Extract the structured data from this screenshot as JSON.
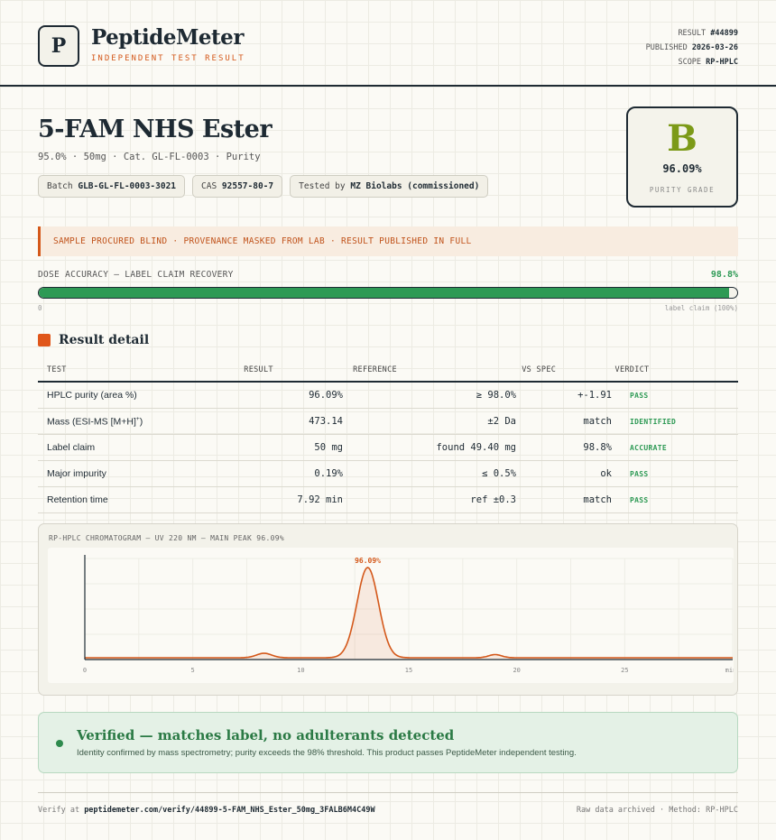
{
  "header": {
    "logo_letter": "P",
    "brand": "PeptideMeter",
    "tagline": "INDEPENDENT TEST RESULT",
    "result_label": "RESULT",
    "result_value": "#44899",
    "published_label": "PUBLISHED",
    "published_value": "2026-03-26",
    "scope_label": "SCOPE",
    "scope_value": "RP-HPLC"
  },
  "product": {
    "name": "5-FAM NHS Ester",
    "subtitle": "95.0% · 50mg · Cat. GL-FL-0003 · Purity",
    "batch_label": "Batch",
    "batch_value": "GLB-GL-FL-0003-3021",
    "cas_label": "CAS",
    "cas_value": "92557-80-7",
    "tested_label": "Tested by",
    "tested_value": "MZ Biolabs (commissioned)"
  },
  "grade": {
    "letter": "B",
    "value": "96.09%",
    "label": "PURITY GRADE"
  },
  "banner": "SAMPLE PROCURED BLIND · PROVENANCE MASKED FROM LAB · RESULT PUBLISHED IN FULL",
  "dose": {
    "label": "DOSE ACCURACY — LABEL CLAIM RECOVERY",
    "value_text": "98.8%",
    "fraction": 0.988,
    "zero_label": "0",
    "right_label": "label claim (100%)"
  },
  "section_title": "Result detail",
  "table": {
    "headers": [
      "TEST",
      "RESULT",
      "REFERENCE",
      "VS SPEC",
      "VERDICT"
    ],
    "rows": [
      {
        "test": "HPLC purity (area %)",
        "result": "96.09%",
        "reference": "≥ 98.0%",
        "vs": "+-1.91",
        "verdict": "PASS"
      },
      {
        "test": "Mass (ESI-MS [M+H]",
        "test_sup": "+",
        "test_end": ")",
        "result": "473.14",
        "reference": "±2 Da",
        "vs": "match",
        "verdict": "IDENTIFIED"
      },
      {
        "test": "Label claim",
        "result": "50 mg",
        "reference": "found 49.40 mg",
        "vs": "98.8%",
        "verdict": "ACCURATE"
      },
      {
        "test": "Major impurity",
        "result": "0.19%",
        "reference": "≤ 0.5%",
        "vs": "ok",
        "verdict": "PASS"
      },
      {
        "test": "Retention time",
        "result": "7.92 min",
        "reference": "ref ±0.3",
        "vs": "match",
        "verdict": "PASS"
      }
    ]
  },
  "chart_data": {
    "type": "line",
    "title": "RP-HPLC CHROMATOGRAM — UV 220 NM — MAIN PEAK 96.09%",
    "xlabel": "",
    "ylabel": "",
    "xlim": [
      0,
      30
    ],
    "x_unit_label": "min",
    "x_ticks": [
      0,
      5,
      10,
      15,
      20,
      25
    ],
    "peak_label": "96.09%",
    "peaks": [
      {
        "x": 8.3,
        "height": 0.05,
        "width": 0.35
      },
      {
        "x": 13.1,
        "height": 1.0,
        "width": 0.5
      },
      {
        "x": 19.0,
        "height": 0.035,
        "width": 0.3
      }
    ],
    "baseline": 0.0,
    "color": "#d4581a"
  },
  "verified": {
    "title": "Verified — matches label, no adulterants detected",
    "text": "Identity confirmed by mass spectrometry; purity exceeds the 98% threshold. This product passes PeptideMeter independent testing."
  },
  "footer": {
    "verify_prefix": "Verify at",
    "verify_url": "peptidemeter.com/verify/44899-5-FAM_NHS_Ester_50mg_3FALB6M4C49W",
    "right": "Raw data archived · Method: RP-HPLC"
  },
  "colors": {
    "accent": "#d4581a",
    "pass": "#2e9a55",
    "grade": "#7c9a18",
    "ink": "#1e2a33"
  }
}
